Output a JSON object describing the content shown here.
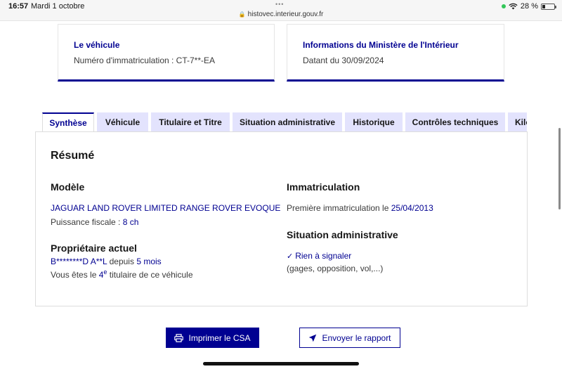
{
  "status_bar": {
    "time": "16:57",
    "date": "Mardi 1 octobre",
    "dots": "•••",
    "url": "histovec.interieur.gouv.fr",
    "battery": "28 %",
    "battery_level": 0.28
  },
  "info_cards": {
    "vehicle": {
      "title": "Le véhicule",
      "text": "Numéro d'immatriculation : CT-7**-EA"
    },
    "ministry": {
      "title": "Informations du Ministère de l'Intérieur",
      "text": "Datant du 30/09/2024"
    }
  },
  "tabs": [
    {
      "label": "Synthèse",
      "active": true
    },
    {
      "label": "Véhicule",
      "active": false
    },
    {
      "label": "Titulaire et Titre",
      "active": false
    },
    {
      "label": "Situation administrative",
      "active": false
    },
    {
      "label": "Historique",
      "active": false
    },
    {
      "label": "Contrôles techniques",
      "active": false
    },
    {
      "label": "Kilométrage",
      "active": false
    }
  ],
  "summary": {
    "heading": "Résumé",
    "model": {
      "heading": "Modèle",
      "name": "JAGUAR LAND ROVER LIMITED RANGE ROVER EVOQUE",
      "fiscal_label": "Puissance fiscale : ",
      "fiscal_value": "8 ch"
    },
    "owner": {
      "heading": "Propriétaire actuel",
      "name": "B********D A**L",
      "since_label": " depuis ",
      "since_value": "5 mois",
      "rank_prefix": "Vous êtes le ",
      "rank_number": "4",
      "rank_suffix": "e",
      "rank_rest": " titulaire de ce véhicule"
    },
    "registration": {
      "heading": "Immatriculation",
      "first_label": "Première immatriculation le ",
      "first_date": "25/04/2013"
    },
    "admin": {
      "heading": "Situation administrative",
      "status": "Rien à signaler",
      "detail": "(gages, opposition, vol,...)"
    }
  },
  "buttons": {
    "print": "Imprimer le CSA",
    "send": "Envoyer le rapport"
  }
}
